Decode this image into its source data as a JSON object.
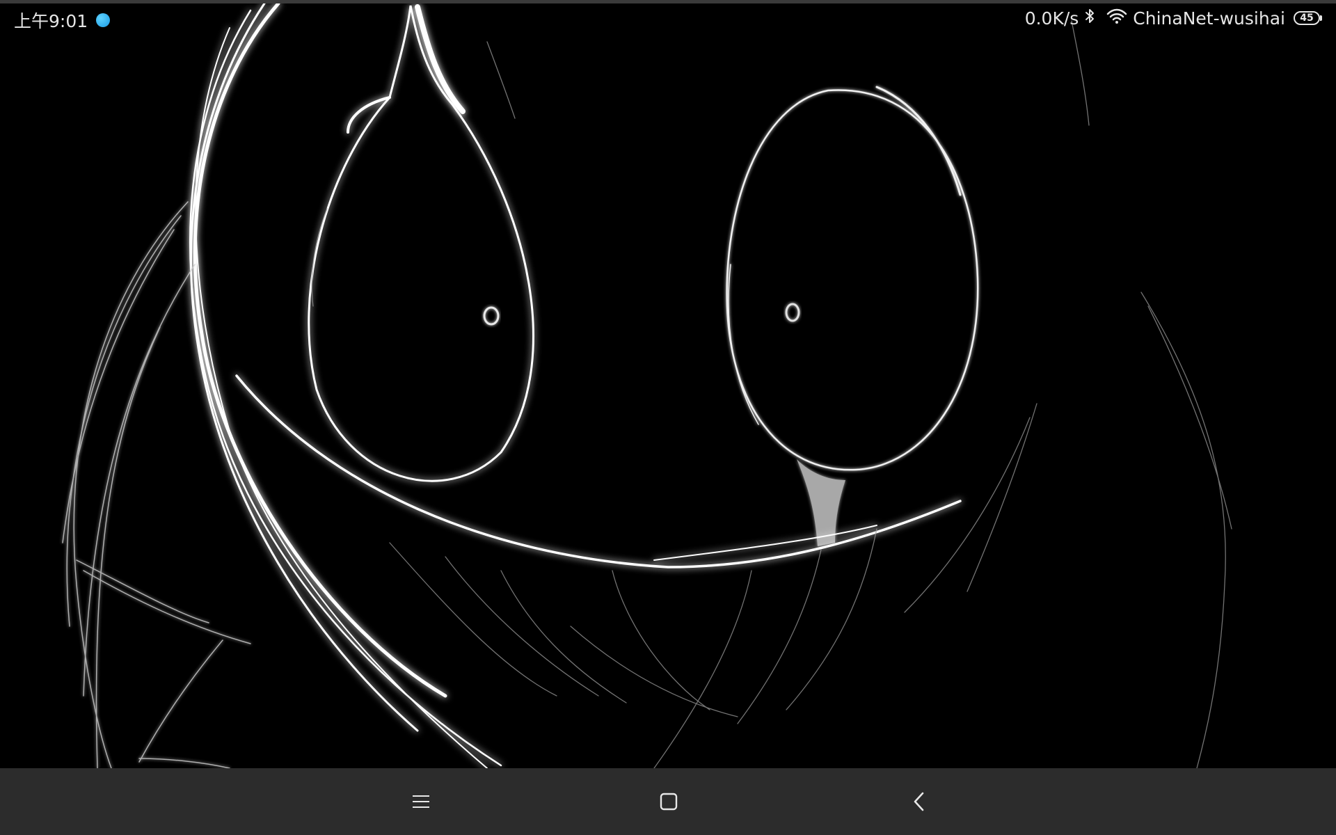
{
  "status_bar": {
    "time": "上午9:01",
    "notification_icon": "blue-circle-icon",
    "network_speed": "0.0K/s",
    "bluetooth_icon": "bluetooth-icon",
    "wifi_icon": "wifi-icon",
    "wifi_name": "ChinaNet-wusihai",
    "battery_level": "45"
  },
  "wallpaper": {
    "description_icon": "dark-sketch-face-wallpaper"
  },
  "nav_bar": {
    "menu_icon": "hamburger-menu-icon",
    "home_icon": "square-home-icon",
    "back_icon": "chevron-left-icon"
  },
  "colors": {
    "background": "#000000",
    "nav_bar": "#2c2c2c",
    "status_text": "#e6e6e6",
    "notification_accent": "#1a9be6"
  }
}
